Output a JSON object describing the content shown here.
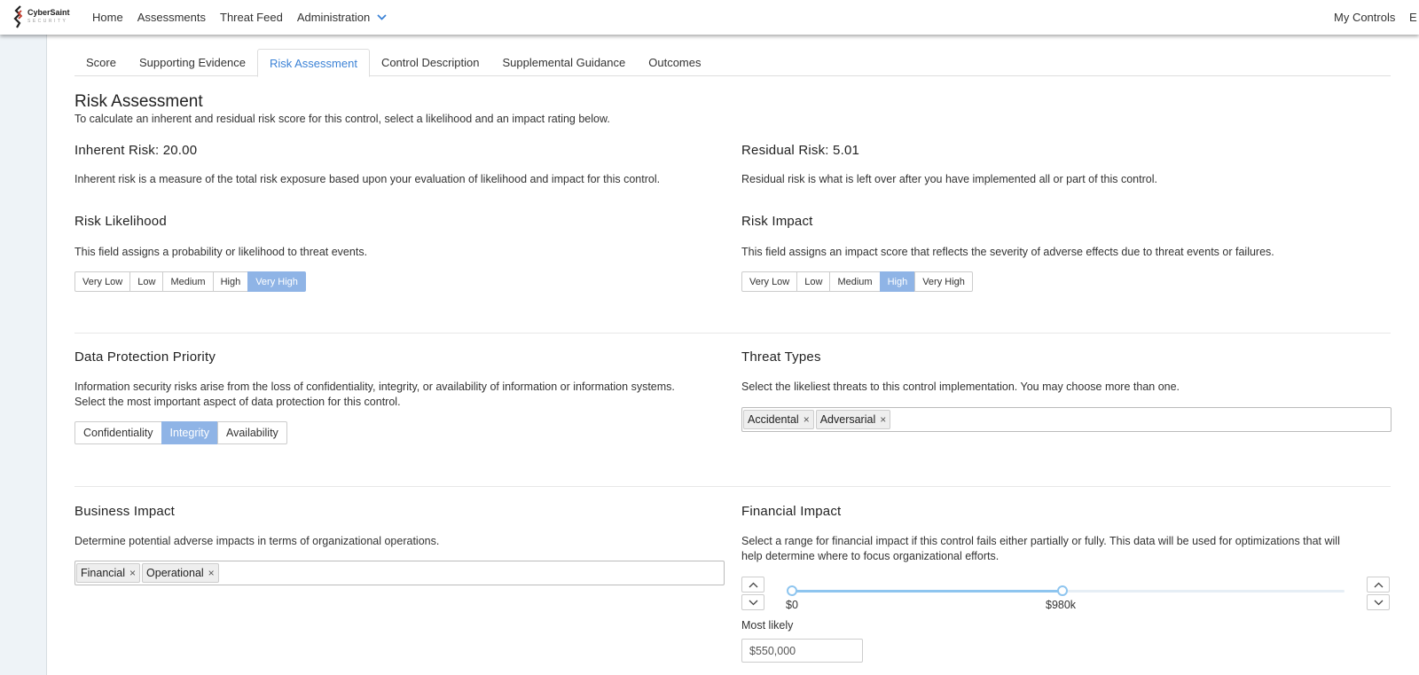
{
  "brand": {
    "name": "CyberSaint",
    "tagline": "SECURITY"
  },
  "nav": {
    "items": [
      "Home",
      "Assessments",
      "Threat Feed",
      "Administration"
    ],
    "right": [
      "My Controls",
      "E"
    ]
  },
  "tabs": [
    "Score",
    "Supporting Evidence",
    "Risk Assessment",
    "Control Description",
    "Supplemental Guidance",
    "Outcomes"
  ],
  "active_tab": "Risk Assessment",
  "risk_assessment": {
    "title": "Risk Assessment",
    "intro": "To calculate an inherent and residual risk score for this control, select a likelihood and an impact rating below."
  },
  "inherent": {
    "title": "Inherent Risk: 20.00",
    "desc": "Inherent risk is a measure of the total risk exposure based upon your evaluation of likelihood and impact for this control."
  },
  "residual": {
    "title": "Residual Risk: 5.01",
    "desc": "Residual risk is what is left over after you have implemented all or part of this control."
  },
  "likelihood": {
    "title": "Risk Likelihood",
    "desc": "This field assigns a probability or likelihood to threat events.",
    "options": [
      "Very Low",
      "Low",
      "Medium",
      "High",
      "Very High"
    ],
    "selected": "Very High"
  },
  "impact": {
    "title": "Risk Impact",
    "desc": "This field assigns an impact score that reflects the severity of adverse effects due to threat events or failures.",
    "options": [
      "Very Low",
      "Low",
      "Medium",
      "High",
      "Very High"
    ],
    "selected": "High"
  },
  "data_protection": {
    "title": "Data Protection Priority",
    "desc_line1": "Information security risks arise from the loss of confidentiality, integrity, or availability of information or information systems.",
    "desc_line2": "Select the most important aspect of data protection for this control.",
    "options": [
      "Confidentiality",
      "Integrity",
      "Availability"
    ],
    "selected": "Integrity"
  },
  "threat_types": {
    "title": "Threat Types",
    "desc": "Select the likeliest threats to this control implementation. You may choose more than one.",
    "tags": [
      "Accidental",
      "Adversarial"
    ]
  },
  "business_impact": {
    "title": "Business Impact",
    "desc": "Determine potential adverse impacts in terms of organizational operations.",
    "tags": [
      "Financial",
      "Operational"
    ]
  },
  "financial_impact": {
    "title": "Financial Impact",
    "desc_line1": "Select a range for financial impact if this control fails either partially or fully. This data will be used for optimizations that will",
    "desc_line2": "help determine where to focus organizational efforts.",
    "range_min_label": "$0",
    "range_max_label": "$980k",
    "range_fill_fraction": 0.49,
    "most_likely_label": "Most likely",
    "most_likely_value": "$550,000"
  },
  "colors": {
    "accent": "#3b82d6",
    "selected_bg": "#8fb4e6",
    "slider": "#8ec5ef"
  },
  "tag_remove_glyph": "×"
}
